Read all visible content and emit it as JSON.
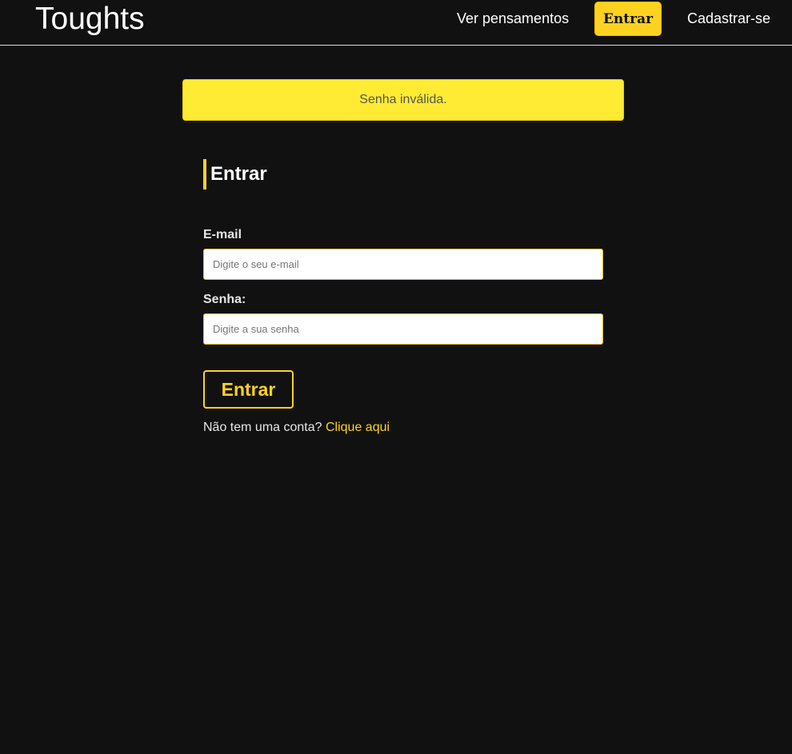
{
  "navbar": {
    "brand": "Toughts",
    "links": {
      "ver_pensamentos": "Ver pensamentos",
      "entrar": "Entrar",
      "cadastrar": "Cadastrar-se"
    }
  },
  "flash": {
    "message": "Senha inválida."
  },
  "form": {
    "title": "Entrar",
    "email_label": "E-mail",
    "email_placeholder": "Digite o seu e-mail",
    "email_value": "",
    "password_label": "Senha:",
    "password_placeholder": "Digite a sua senha",
    "password_value": "",
    "submit_label": "Entrar",
    "signup_prompt": "Não tem uma conta?",
    "signup_link": "Clique aqui"
  },
  "colors": {
    "background": "#111111",
    "accent": "#ffd21f",
    "flash_background": "#ffeb33"
  }
}
